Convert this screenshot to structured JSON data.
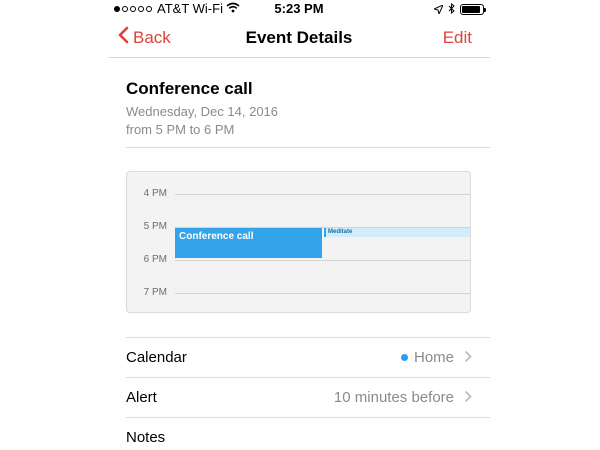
{
  "status_bar": {
    "carrier": "AT&T Wi-Fi",
    "time": "5:23 PM",
    "signal_icon": "signal-dots-icon",
    "wifi_icon": "wifi-icon",
    "location_icon": "location-arrow-icon",
    "bluetooth_icon": "bluetooth-icon",
    "battery_icon": "battery-icon",
    "battery_level": 0.9
  },
  "navbar": {
    "back_label": "Back",
    "title": "Event Details",
    "edit_label": "Edit",
    "accent_color": "#e0413b"
  },
  "event": {
    "title": "Conference call",
    "date": "Wednesday, Dec 14, 2016",
    "time_range": "from 5 PM to 6 PM"
  },
  "day_view": {
    "hours": [
      "4 PM",
      "5 PM",
      "6 PM",
      "7 PM"
    ],
    "events": [
      {
        "label": "Conference call",
        "color": "#34a4ea"
      },
      {
        "label": "Meditate",
        "color": "#d4ecfa"
      }
    ]
  },
  "details": {
    "calendar_label": "Calendar",
    "calendar_value": "Home",
    "calendar_color": "#2d9bf0",
    "alert_label": "Alert",
    "alert_value": "10 minutes before",
    "notes_label": "Notes"
  }
}
